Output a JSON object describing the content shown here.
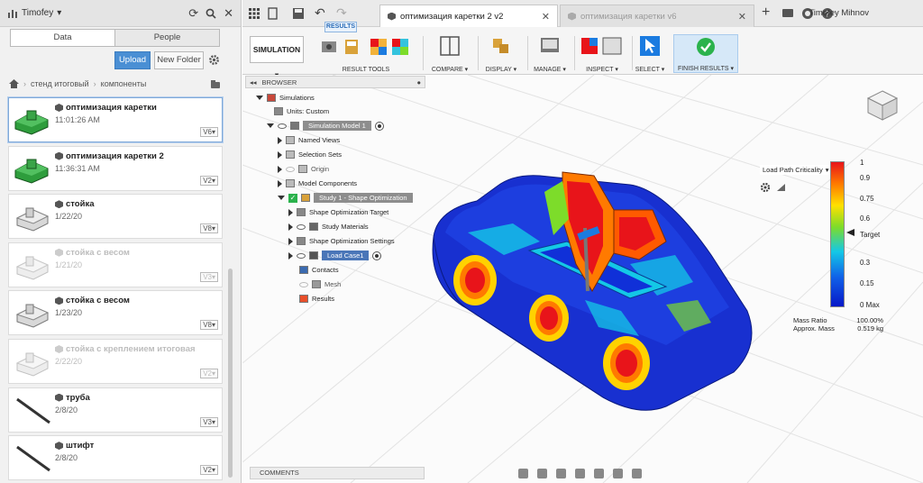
{
  "left_panel": {
    "user": "Timofey",
    "tabs": [
      "Data",
      "People"
    ],
    "upload_label": "Upload",
    "new_folder_label": "New Folder",
    "breadcrumb": [
      "стенд итоговый",
      "компоненты"
    ],
    "files": [
      {
        "name": "оптимизация каретки",
        "date": "11:01:26 AM",
        "version": "V6",
        "selected": true,
        "faded": false
      },
      {
        "name": "оптимизация каретки 2",
        "date": "11:36:31 AM",
        "version": "V2",
        "selected": false,
        "faded": false
      },
      {
        "name": "стойка",
        "date": "1/22/20",
        "version": "V8",
        "selected": false,
        "faded": false
      },
      {
        "name": "стойка с весом",
        "date": "1/21/20",
        "version": "V3",
        "selected": false,
        "faded": true
      },
      {
        "name": "стойка с весом",
        "date": "1/23/20",
        "version": "V8",
        "selected": false,
        "faded": false
      },
      {
        "name": "стойка с креплением итоговая",
        "date": "2/22/20",
        "version": "V2",
        "selected": false,
        "faded": true
      },
      {
        "name": "труба",
        "date": "2/8/20",
        "version": "V3",
        "selected": false,
        "faded": false
      },
      {
        "name": "штифт",
        "date": "2/8/20",
        "version": "V2",
        "selected": false,
        "faded": false
      }
    ]
  },
  "topbar": {
    "tabs": [
      {
        "label": "оптимизация каретки 2 v2",
        "active": true
      },
      {
        "label": "оптимизация каретки v6",
        "active": false
      }
    ],
    "user_name": "Timofey Mihnov"
  },
  "ribbon": {
    "workspace": "SIMULATION",
    "active_tab": "RESULTS",
    "groups": [
      "RESULT TOOLS",
      "COMPARE",
      "DISPLAY",
      "MANAGE",
      "INSPECT",
      "SELECT",
      "FINISH RESULTS"
    ]
  },
  "browser": {
    "title": "BROWSER",
    "nodes": [
      "Simulations",
      "Units: Custom",
      "Simulation Model 1",
      "Named Views",
      "Selection Sets",
      "Origin",
      "Model Components",
      "Study 1 - Shape Optimization",
      "Shape Optimization Target",
      "Study Materials",
      "Shape Optimization Settings",
      "Load Case1",
      "Contacts",
      "Mesh",
      "Results"
    ]
  },
  "legend": {
    "title": "Load Path Criticality",
    "ticks": [
      "1",
      "0.9",
      "0.75",
      "0.6",
      "Target",
      "0.3",
      "0.15",
      "0 Max"
    ],
    "mass_ratio_label": "Mass Ratio",
    "mass_ratio_value": "100.00%",
    "approx_mass_label": "Approx. Mass",
    "approx_mass_value": "0.519 kg"
  },
  "comments_label": "COMMENTS",
  "colors": {
    "accent": "#4a8fd4",
    "finish": "#2bb24c",
    "heat_red": "#e8141a",
    "heat_blue": "#1030d8"
  }
}
